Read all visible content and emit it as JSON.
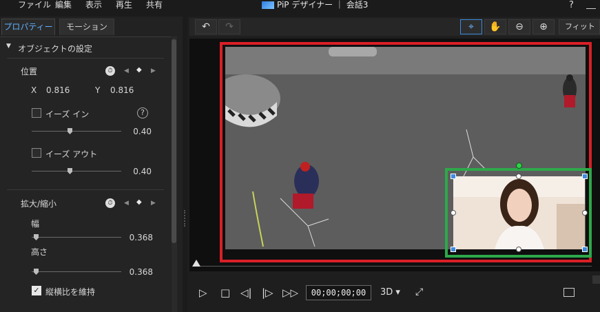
{
  "menu": {
    "file": "ファイル",
    "edit": "編集",
    "view": "表示",
    "play": "再生",
    "share": "共有"
  },
  "window": {
    "title": "PiP デザイナー ｜ 会話3",
    "help": "?"
  },
  "tabs": {
    "properties": "プロパティー",
    "motion": "モーション"
  },
  "object_settings": {
    "header": "オブジェクトの設定"
  },
  "position": {
    "label": "位置",
    "x_label": "X",
    "x_value": "0.816",
    "y_label": "Y",
    "y_value": "0.816",
    "ease_in_label": "イーズ イン",
    "ease_in_value": "0.40",
    "ease_in_level": 0.4,
    "ease_out_label": "イーズ アウト",
    "ease_out_value": "0.40",
    "ease_out_level": 0.4
  },
  "scale": {
    "label": "拡大/縮小",
    "width_label": "幅",
    "width_value": "0.368",
    "height_label": "高さ",
    "height_value": "0.368",
    "keep_aspect_label": "縦横比を維持",
    "keep_aspect_checked": true
  },
  "toolbar": {
    "fit_label": "フィット"
  },
  "playback": {
    "timecode": "00;00;00;00",
    "mode_3d": "3D"
  },
  "colors": {
    "accent": "#3c8ce0",
    "red_frame": "#d91f26",
    "green_frame": "#2ea84a"
  }
}
